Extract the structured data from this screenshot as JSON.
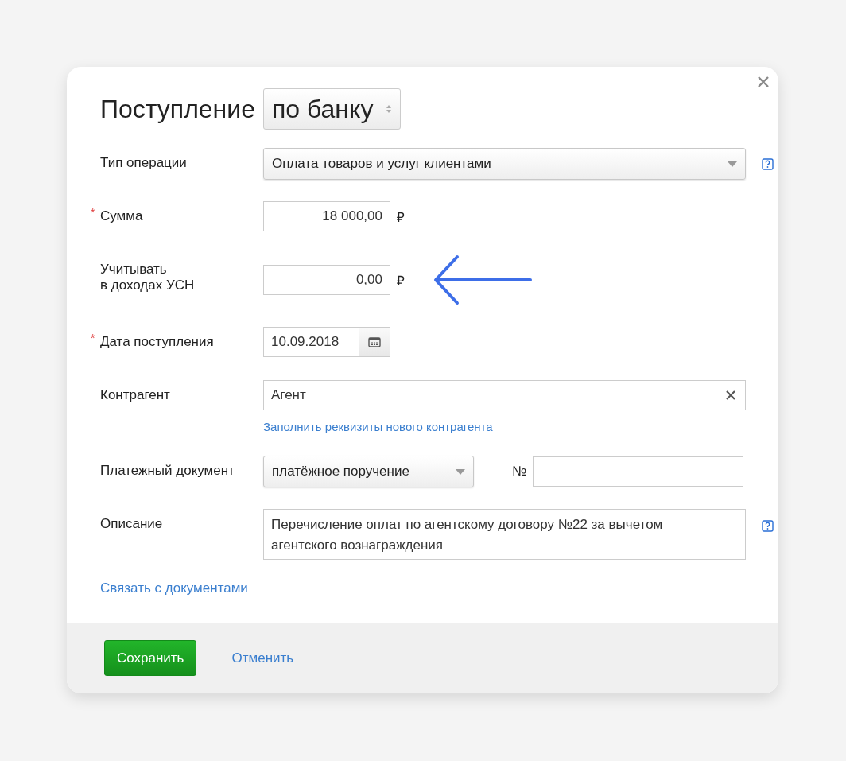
{
  "dialog": {
    "title": "Поступление",
    "source_select": {
      "value": "по банку"
    }
  },
  "fields": [
    {
      "kind": "select",
      "label": "Тип операции",
      "value": "Оплата товаров и услуг клиентами",
      "help": true
    },
    {
      "kind": "amount",
      "label": "Сумма",
      "marker": "*",
      "value": "18 000,00",
      "currency": "₽"
    },
    {
      "kind": "amount",
      "label": "Учитывать\nв доходах УСН",
      "value": "0,00",
      "currency": "₽",
      "annotated": true
    },
    {
      "kind": "date",
      "label": "Дата поступления",
      "marker": "*",
      "value": "10.09.2018"
    },
    {
      "kind": "clearable",
      "label": "Контрагент",
      "value": "Агент",
      "link": "Заполнить реквизиты нового контрагента"
    },
    {
      "kind": "document",
      "label": "Платежный документ",
      "value": "платёжное поручение",
      "number_label": "№"
    },
    {
      "kind": "textarea",
      "label": "Описание",
      "value": "Перечисление оплат по агентскому договору №22 за вычетом агентского вознаграждения",
      "help": true
    }
  ],
  "link_documents": "Связать с документами",
  "buttons": {
    "save": "Сохранить",
    "cancel": "Отменить"
  }
}
